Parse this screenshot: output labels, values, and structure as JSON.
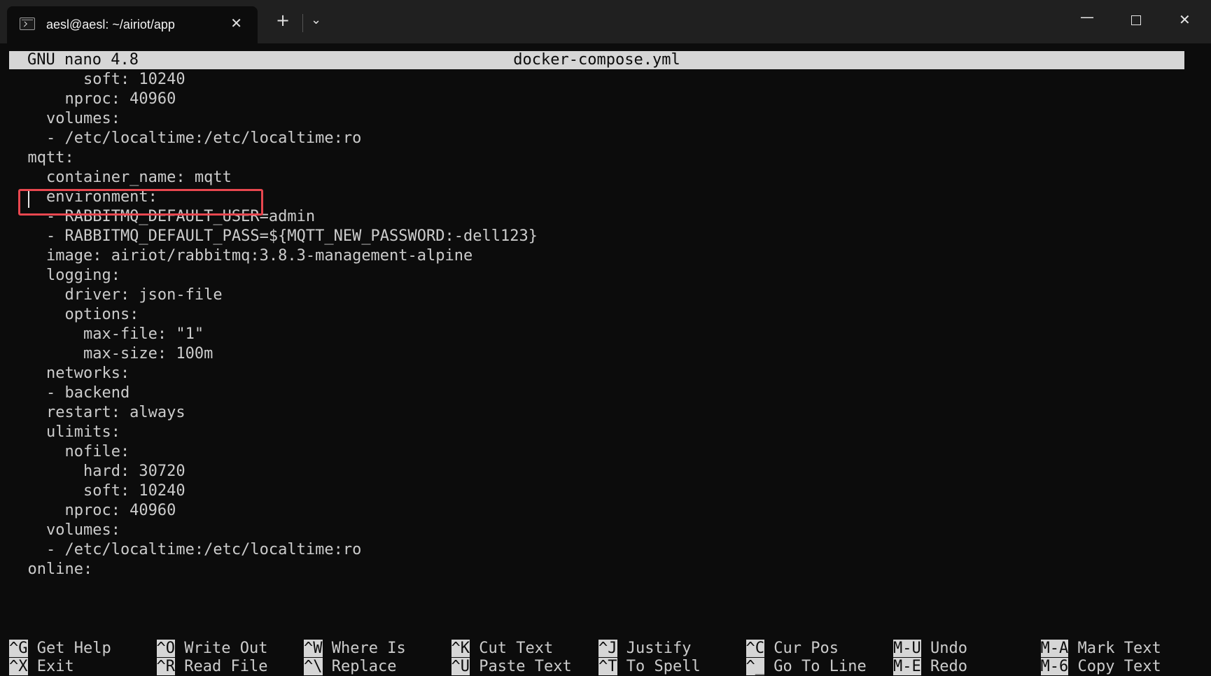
{
  "window": {
    "tab_title": "aesl@aesl: ~/airiot/app",
    "tab_close_glyph": "✕",
    "new_tab_glyph": "+",
    "dropdown_glyph": "⌄",
    "minimize_glyph": "—",
    "close_glyph": "✕"
  },
  "nano": {
    "version": "GNU nano 4.8",
    "filename": "docker-compose.yml"
  },
  "lines": [
    "        soft: 10240",
    "      nproc: 40960",
    "    volumes:",
    "    - /etc/localtime:/etc/localtime:ro",
    "  mqtt:",
    "    container_name: mqtt",
    "    environment:",
    "    - RABBITMQ_DEFAULT_USER=admin",
    "    - RABBITMQ_DEFAULT_PASS=${MQTT_NEW_PASSWORD:-dell123}",
    "    image: airiot/rabbitmq:3.8.3-management-alpine",
    "    logging:",
    "      driver: json-file",
    "      options:",
    "        max-file: \"1\"",
    "        max-size: 100m",
    "    networks:",
    "    - backend",
    "    restart: always",
    "    ulimits:",
    "      nofile:",
    "        hard: 30720",
    "        soft: 10240",
    "      nproc: 40960",
    "    volumes:",
    "    - /etc/localtime:/etc/localtime:ro",
    "  online:"
  ],
  "shortcuts": [
    {
      "key": "^G",
      "label": "Get Help"
    },
    {
      "key": "^O",
      "label": "Write Out"
    },
    {
      "key": "^W",
      "label": "Where Is"
    },
    {
      "key": "^K",
      "label": "Cut Text"
    },
    {
      "key": "^J",
      "label": "Justify"
    },
    {
      "key": "^C",
      "label": "Cur Pos"
    },
    {
      "key": "M-U",
      "label": "Undo"
    },
    {
      "key": "M-A",
      "label": "Mark Text"
    },
    {
      "key": "^X",
      "label": "Exit"
    },
    {
      "key": "^R",
      "label": "Read File"
    },
    {
      "key": "^\\",
      "label": "Replace"
    },
    {
      "key": "^U",
      "label": "Paste Text"
    },
    {
      "key": "^T",
      "label": "To Spell"
    },
    {
      "key": "^_",
      "label": "Go To Line"
    },
    {
      "key": "M-E",
      "label": "Redo"
    },
    {
      "key": "M-6",
      "label": "Copy Text"
    }
  ],
  "colors": {
    "terminal_bg": "#0c0c0c",
    "titlebar_bg": "#202020",
    "highlight_box": "#e8474f",
    "status_bar_bg": "#d6d6d6"
  }
}
